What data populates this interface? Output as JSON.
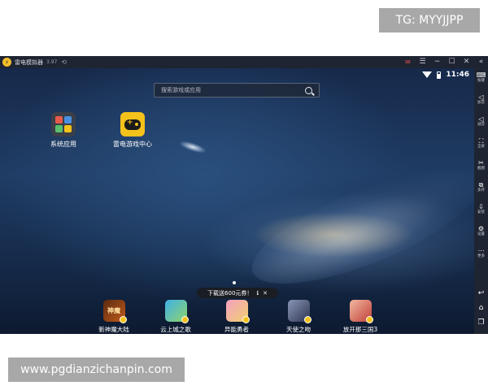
{
  "watermarks": {
    "top": "TG: MYYJJPP",
    "bottom": "www.pgdianzichanpin.com"
  },
  "titlebar": {
    "title": "雷电模拟器",
    "version": "3.97",
    "controls": [
      "mail-icon",
      "menu-icon",
      "minimize-icon",
      "maximize-icon",
      "close-icon",
      "expand-icon"
    ]
  },
  "statusbar": {
    "time": "11:46"
  },
  "search": {
    "placeholder": "搜索游戏或应用"
  },
  "desktop": {
    "icons": [
      {
        "label": "系统应用"
      },
      {
        "label": "雷电游戏中心"
      }
    ]
  },
  "promo": {
    "text": "下载送600元券！",
    "info": "ℹ",
    "close": "✕"
  },
  "dock": {
    "apps": [
      {
        "label": "新神魔大陆",
        "tile_text": "神魔"
      },
      {
        "label": "云上城之歌"
      },
      {
        "label": "异能勇者"
      },
      {
        "label": "天使之吻"
      },
      {
        "label": "放开那三国3"
      }
    ]
  },
  "sidebar": {
    "items": [
      {
        "icon": "keyboard-icon",
        "label": "按键"
      },
      {
        "icon": "volume-up-icon",
        "label": "加音"
      },
      {
        "icon": "volume-down-icon",
        "label": "减音"
      },
      {
        "icon": "fullscreen-icon",
        "label": "全屏"
      },
      {
        "icon": "scissors-icon",
        "label": "截图"
      },
      {
        "icon": "multi-instance-icon",
        "label": "多开"
      },
      {
        "icon": "install-icon",
        "label": "安装"
      },
      {
        "icon": "settings-icon",
        "label": "设置"
      },
      {
        "icon": "more-icon",
        "label": "更多"
      }
    ],
    "nav": [
      "back-icon",
      "home-icon",
      "recent-icon"
    ]
  },
  "colors": {
    "accent": "#f5c21c",
    "titlebar": "#1e2431",
    "watermark_bg": "#a8a8a8"
  }
}
